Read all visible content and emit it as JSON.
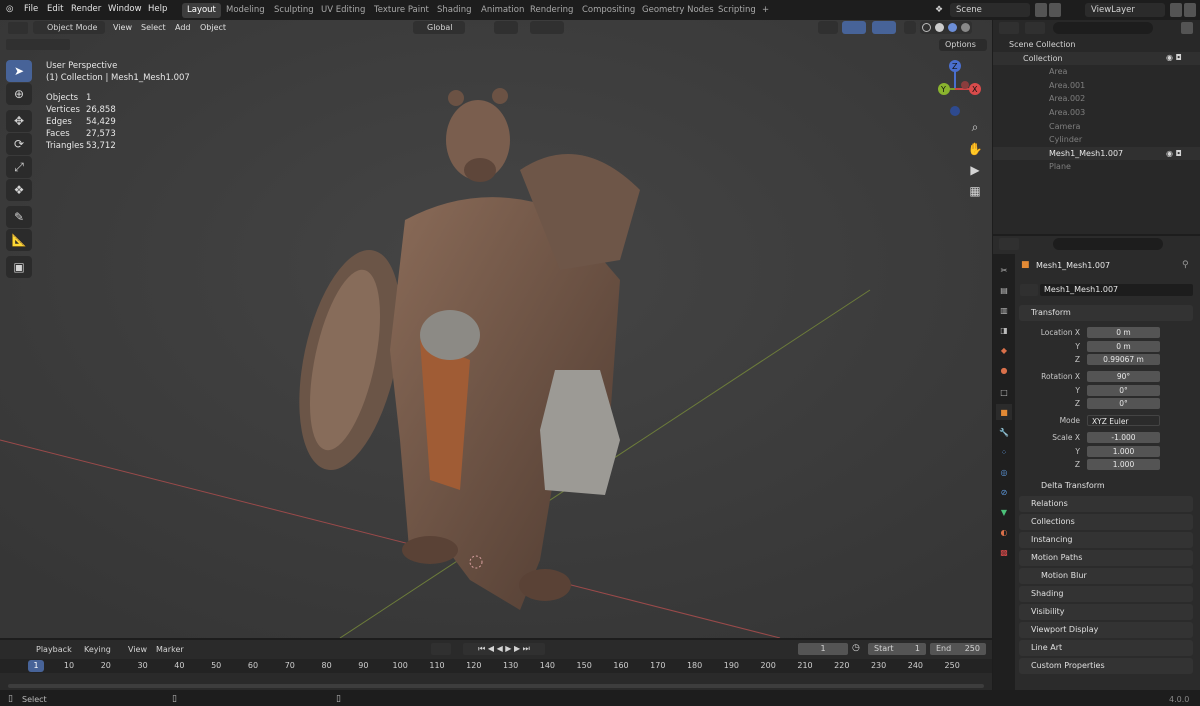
{
  "menu": {
    "file": "File",
    "edit": "Edit",
    "render": "Render",
    "window": "Window",
    "help": "Help"
  },
  "workspaces": [
    "Layout",
    "Modeling",
    "Sculpting",
    "UV Editing",
    "Texture Paint",
    "Shading",
    "Animation",
    "Rendering",
    "Compositing",
    "Geometry Nodes",
    "Scripting",
    "+"
  ],
  "scene": {
    "name": "Scene",
    "view_layer": "ViewLayer"
  },
  "viewport_header": {
    "mode": "Object Mode",
    "view": "View",
    "select": "Select",
    "add": "Add",
    "object": "Object",
    "orientation": "Global",
    "options": "Options"
  },
  "viewport_info": {
    "perspective": "User Perspective",
    "collection": "(1) Collection | Mesh1_Mesh1.007"
  },
  "stats": [
    {
      "label": "Objects",
      "value": "1"
    },
    {
      "label": "Vertices",
      "value": "26,858"
    },
    {
      "label": "Edges",
      "value": "54,429"
    },
    {
      "label": "Faces",
      "value": "27,573"
    },
    {
      "label": "Triangles",
      "value": "53,712"
    }
  ],
  "gizmo": {
    "z": "Z",
    "x": "X",
    "y": "Y"
  },
  "outliner": {
    "scene_collection": "Scene Collection",
    "collection": "Collection",
    "items": [
      "Area",
      "Area.001",
      "Area.002",
      "Area.003",
      "Camera",
      "Cylinder",
      "Mesh1_Mesh1.007",
      "Plane"
    ]
  },
  "properties": {
    "object_name": "Mesh1_Mesh1.007",
    "name_field": "Mesh1_Mesh1.007",
    "transform": "Transform",
    "location_label": "Location X",
    "y": "Y",
    "z": "Z",
    "location": [
      "0 m",
      "0 m",
      "0.99067 m"
    ],
    "rotation_label": "Rotation X",
    "rotation": [
      "90°",
      "0°",
      "0°"
    ],
    "mode_label": "Mode",
    "mode": "XYZ Euler",
    "scale_label": "Scale X",
    "scale": [
      "-1.000",
      "1.000",
      "1.000"
    ],
    "delta": "Delta Transform",
    "panels": [
      "Relations",
      "Collections",
      "Instancing",
      "Motion Paths",
      "Motion Blur",
      "Shading",
      "Visibility",
      "Viewport Display",
      "Line Art",
      "Custom Properties"
    ]
  },
  "timeline": {
    "playback": "Playback",
    "keying": "Keying",
    "view": "View",
    "marker": "Marker",
    "current": "1",
    "start_label": "Start",
    "start": "1",
    "end_label": "End",
    "end": "250",
    "frames": [
      "1",
      "10",
      "20",
      "30",
      "40",
      "50",
      "60",
      "70",
      "80",
      "90",
      "100",
      "110",
      "120",
      "130",
      "140",
      "150",
      "160",
      "170",
      "180",
      "190",
      "200",
      "210",
      "220",
      "230",
      "240",
      "250"
    ]
  },
  "status": {
    "select": "Select",
    "version": "4.0.0"
  }
}
